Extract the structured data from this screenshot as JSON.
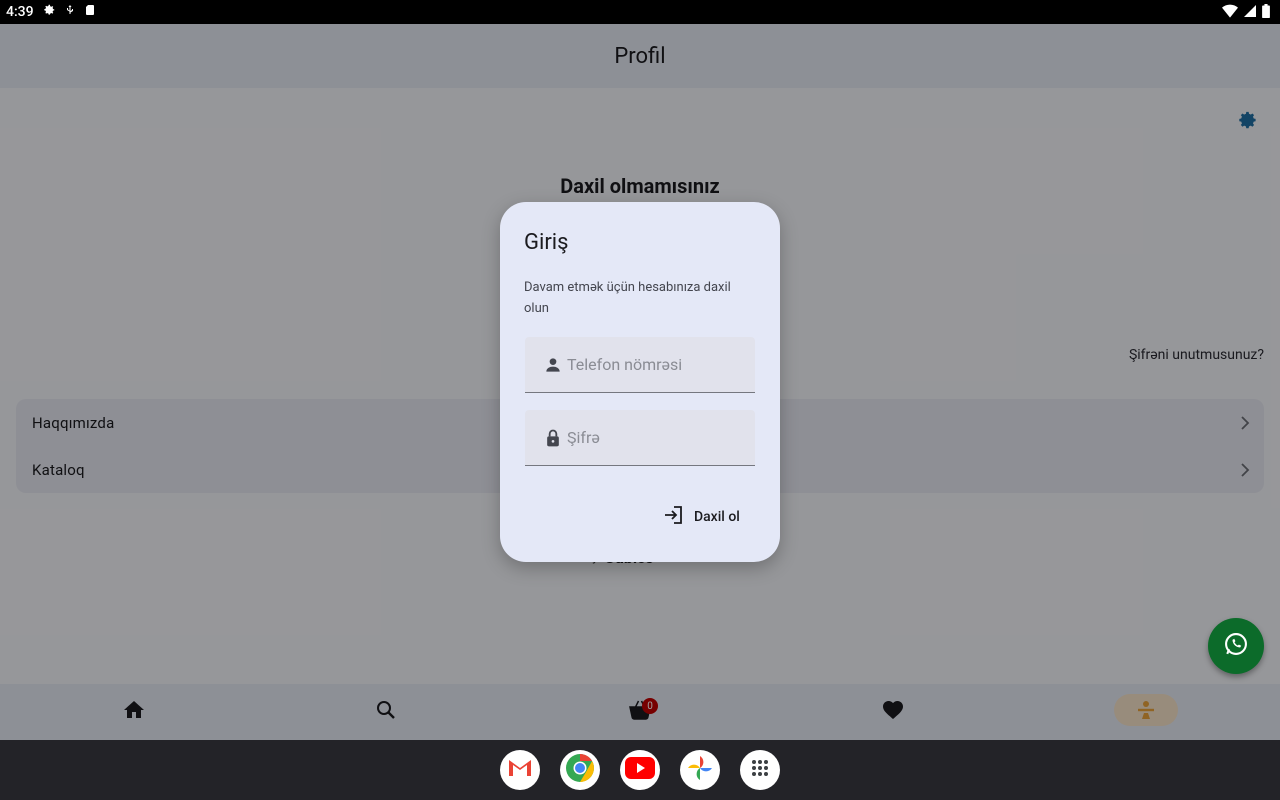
{
  "status_bar": {
    "time": "4:39"
  },
  "app_bar": {
    "title": "Profil"
  },
  "profile": {
    "headline": "Daxil olmamısınız",
    "forgot_password": "Şifrəni unutmusunuz?",
    "menu_items": [
      {
        "label": "Haqqımızda"
      },
      {
        "label": "Kataloq"
      }
    ],
    "footer": {
      "prefix": "by",
      "brand": "Cubics"
    }
  },
  "dialog": {
    "title": "Giriş",
    "message": "Davam etmək üçün hesabınıza daxil olun",
    "phone_placeholder": "Telefon nömrəsi",
    "password_placeholder": "Şifrə",
    "login_label": "Daxil ol"
  },
  "bottom_nav": {
    "items": [
      {
        "icon": "home-icon"
      },
      {
        "icon": "search-icon"
      },
      {
        "icon": "cart-icon",
        "badge": "0"
      },
      {
        "icon": "heart-icon"
      },
      {
        "icon": "profile-icon",
        "selected": true
      }
    ]
  },
  "taskbar": {
    "apps": [
      "Gmail",
      "Chrome",
      "YouTube",
      "Photos",
      "App drawer"
    ]
  },
  "colors": {
    "accent": "#e8a23a",
    "fab": "#0c6b2a",
    "dialog_bg": "#e4e8f7"
  }
}
